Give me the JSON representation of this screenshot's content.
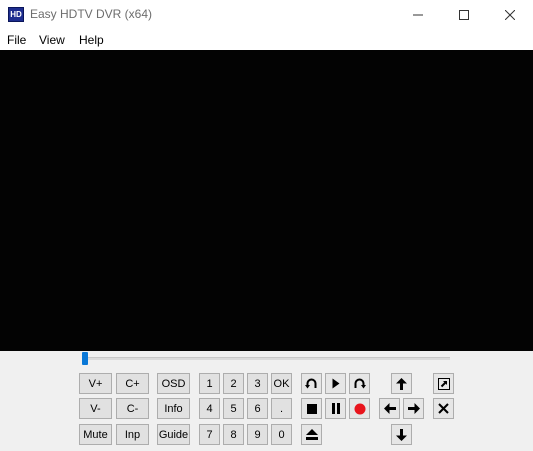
{
  "window": {
    "title": "Easy HDTV DVR (x64)",
    "icon_label": "HD"
  },
  "menu": {
    "items": [
      "File",
      "View",
      "Help"
    ]
  },
  "seek": {
    "position": 0.0
  },
  "controls": {
    "vol_up": "V+",
    "vol_down": "V-",
    "mute": "Mute",
    "ch_up": "C+",
    "ch_down": "C-",
    "input": "Inp",
    "osd": "OSD",
    "info": "Info",
    "guide": "Guide",
    "num_1": "1",
    "num_2": "2",
    "num_3": "3",
    "ok": "OK",
    "num_4": "4",
    "num_5": "5",
    "num_6": "6",
    "dot": ".",
    "num_7": "7",
    "num_8": "8",
    "num_9": "9",
    "num_0": "0"
  },
  "icons": {
    "rewind": "rewind-icon",
    "play": "play-icon",
    "forward": "forward-icon",
    "stop": "stop-icon",
    "pause": "pause-icon",
    "record": "record-icon",
    "eject": "eject-icon",
    "up": "arrow-up-icon",
    "left": "arrow-left-icon",
    "right": "arrow-right-icon",
    "down": "arrow-down-icon",
    "popout": "popout-icon",
    "close": "close-icon"
  },
  "colors": {
    "record": "#e8141c",
    "seek_thumb": "#0a78d7"
  }
}
